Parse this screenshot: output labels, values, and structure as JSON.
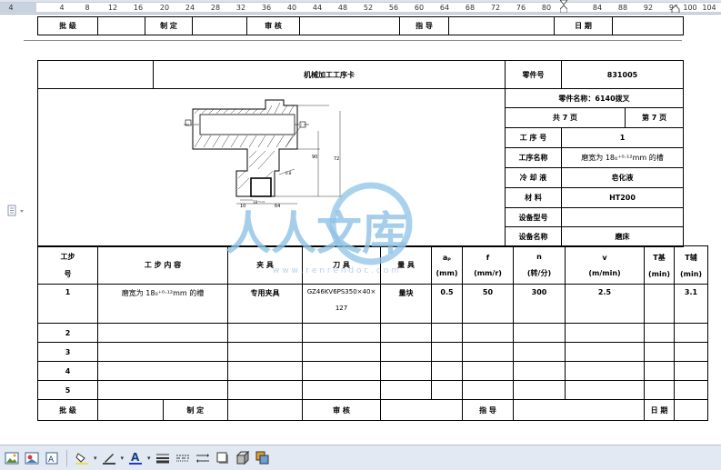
{
  "ruler": {
    "numbers": [
      "4",
      "4",
      "8",
      "12",
      "16",
      "20",
      "24",
      "28",
      "32",
      "36",
      "40",
      "44",
      "48",
      "52",
      "56",
      "60",
      "64",
      "68",
      "72",
      "76",
      "80",
      "84",
      "88",
      "92",
      "96",
      "100",
      "104"
    ]
  },
  "top_approval": {
    "cells": [
      "批 级",
      "",
      "制 定",
      "",
      "审 核",
      "",
      "指 导",
      "",
      "日 期",
      ""
    ]
  },
  "header": {
    "title": "机械加工工序卡",
    "part_no_label": "零件号",
    "part_no_value": "831005",
    "part_name": "零件名称：6140拨叉",
    "total_pages": "共  7  页",
    "page_no": "第 7 页",
    "process_no_label": "工 序 号",
    "process_no_value": "1",
    "process_name_label": "工序名称",
    "process_name_value": "磨宽为 18₀⁺⁰·¹²mm 的槽",
    "coolant_label": "冷 却 液",
    "coolant_value": "皂化液",
    "material_label": "材    料",
    "material_value": "HT200",
    "equipment_model_label": "设备型号",
    "equipment_model_value": "",
    "equipment_name_label": "设备名称",
    "equipment_name_value": "磨床"
  },
  "drawing": {
    "dim_90": "90",
    "dim_72": "72",
    "dim_10": "10",
    "dim_64": "64",
    "dim_18": "18⁺⁰·¹²",
    "dim_ra": "0.8"
  },
  "steps_header": {
    "step_no": "工步\n号",
    "step_no_top": "工步",
    "step_no_bottom": "号",
    "content": "工 步 内 容",
    "fixture": "夹 具",
    "tool": "刀 具",
    "gauge": "量 具",
    "ap_top": "aₚ",
    "ap_bottom": "(mm)",
    "f_top": "f",
    "f_bottom": "(mm/r)",
    "n_top": "n",
    "n_bottom": "(转/分)",
    "v_top": "v",
    "v_bottom": "(m/min)",
    "tj_top": "T基",
    "tj_bottom": "(min)",
    "tf_top": "T辅",
    "tf_bottom": "(min)"
  },
  "steps": [
    {
      "no": "1",
      "content": "磨宽为 18₀⁺⁰·¹²mm 的槽",
      "fixture": "专用夹具",
      "tool_l1": "GZ46KV6PS350×40×",
      "tool_l2": "127",
      "gauge": "量块",
      "ap": "0.5",
      "f": "50",
      "n": "300",
      "v": "2.5",
      "tj": "",
      "tf": "3.1"
    },
    {
      "no": "2",
      "content": "",
      "fixture": "",
      "tool_l1": "",
      "tool_l2": "",
      "gauge": "",
      "ap": "",
      "f": "",
      "n": "",
      "v": "",
      "tj": "",
      "tf": ""
    },
    {
      "no": "3",
      "content": "",
      "fixture": "",
      "tool_l1": "",
      "tool_l2": "",
      "gauge": "",
      "ap": "",
      "f": "",
      "n": "",
      "v": "",
      "tj": "",
      "tf": ""
    },
    {
      "no": "4",
      "content": "",
      "fixture": "",
      "tool_l1": "",
      "tool_l2": "",
      "gauge": "",
      "ap": "",
      "f": "",
      "n": "",
      "v": "",
      "tj": "",
      "tf": ""
    },
    {
      "no": "5",
      "content": "",
      "fixture": "",
      "tool_l1": "",
      "tool_l2": "",
      "gauge": "",
      "ap": "",
      "f": "",
      "n": "",
      "v": "",
      "tj": "",
      "tf": ""
    }
  ],
  "bottom_approval": {
    "cells": [
      "批 级",
      "",
      "制 定",
      "",
      "审 核",
      "",
      "指 导",
      "",
      "日 期",
      ""
    ]
  },
  "watermark": {
    "text": "人人文库",
    "url": "w w w . r e n r e n d o c . c o m"
  },
  "colors": {
    "watermark": "#8fc3e6",
    "toolbar": "#e3e9f2",
    "ruler": "#dde4ee"
  }
}
